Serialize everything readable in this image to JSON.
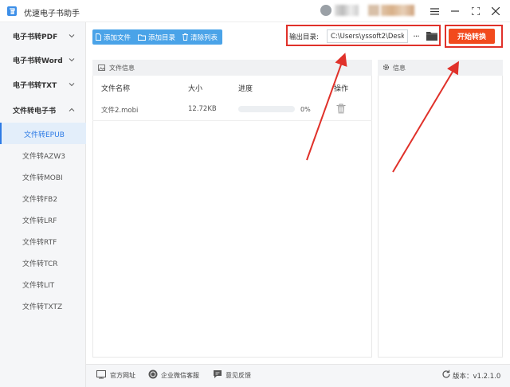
{
  "app": {
    "title": "优速电子书助手"
  },
  "colors": {
    "accent": "#2d7be5",
    "toolbar": "#4aa3e8",
    "start": "#f24a1d",
    "highlight": "#e0312a"
  },
  "sidebar": {
    "groups": [
      {
        "label": "电子书转PDF",
        "expanded": false
      },
      {
        "label": "电子书转Word",
        "expanded": false
      },
      {
        "label": "电子书转TXT",
        "expanded": false
      },
      {
        "label": "文件转电子书",
        "expanded": true
      }
    ],
    "items": [
      {
        "label": "文件转EPUB",
        "active": true
      },
      {
        "label": "文件转AZW3"
      },
      {
        "label": "文件转MOBI"
      },
      {
        "label": "文件转FB2"
      },
      {
        "label": "文件转LRF"
      },
      {
        "label": "文件转RTF"
      },
      {
        "label": "文件转TCR"
      },
      {
        "label": "文件转LIT"
      },
      {
        "label": "文件转TXTZ"
      }
    ]
  },
  "toolbar": {
    "add_file": "添加文件",
    "add_folder": "添加目录",
    "clear_list": "清除列表"
  },
  "output": {
    "label": "输出目录:",
    "path": "C:\\Users\\yssoft2\\Deskt",
    "more": "···",
    "start": "开始转换"
  },
  "file_panel": {
    "title": "文件信息",
    "columns": [
      "文件名称",
      "大小",
      "进度",
      "操作"
    ],
    "rows": [
      {
        "name": "文件2.mobi",
        "size": "12.72KB",
        "progress": 0,
        "progress_label": "0%"
      }
    ]
  },
  "info_panel": {
    "title": "信息"
  },
  "footer": {
    "website": "官方网址",
    "wechat": "企业微信客服",
    "feedback": "意见反馈",
    "version": "版本：v1.2.1.0"
  }
}
